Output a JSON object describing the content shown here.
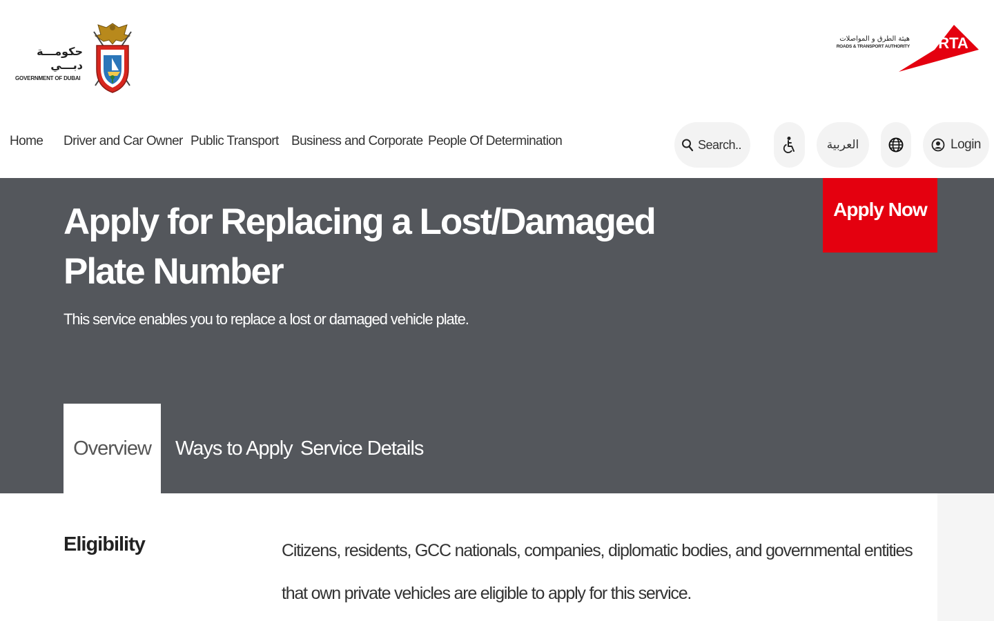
{
  "header": {
    "gov_logo": {
      "arabic": "حكومـــة دبـــي",
      "english": "GOVERNMENT OF DUBAI"
    },
    "rta_logo": {
      "arabic": "هيئة الطرق و المواصلات",
      "english": "ROADS & TRANSPORT AUTHORITY",
      "mark": "RTA"
    },
    "colors": {
      "brand_red": "#e4000f"
    }
  },
  "nav": {
    "items": [
      {
        "label": "Home"
      },
      {
        "label": "Driver and Car Owner"
      },
      {
        "label": "Public Transport"
      },
      {
        "label": "Business and Corporate"
      },
      {
        "label": "People Of Determination"
      }
    ],
    "search": {
      "label": "Search..",
      "icon": "search-icon"
    },
    "accessibility": {
      "icon": "accessibility-icon"
    },
    "language": {
      "label": "العربية"
    },
    "globe": {
      "icon": "globe-icon"
    },
    "login": {
      "label": "Login",
      "icon": "user-icon"
    }
  },
  "hero": {
    "title": "Apply for Replacing a Lost/Damaged Plate Number",
    "subtitle": "This service enables you to replace a lost or damaged vehicle plate.",
    "apply_label": "Apply Now",
    "background": "#54575c"
  },
  "tabs": [
    {
      "label": "Overview",
      "active": true
    },
    {
      "label": "Ways to Apply",
      "active": false
    },
    {
      "label": "Service Details",
      "active": false
    }
  ],
  "content": {
    "eligibility_label": "Eligibility",
    "eligibility_text": "Citizens, residents, GCC nationals, companies, diplomatic bodies, and governmental entities that own private vehicles are eligible to apply for this service."
  }
}
